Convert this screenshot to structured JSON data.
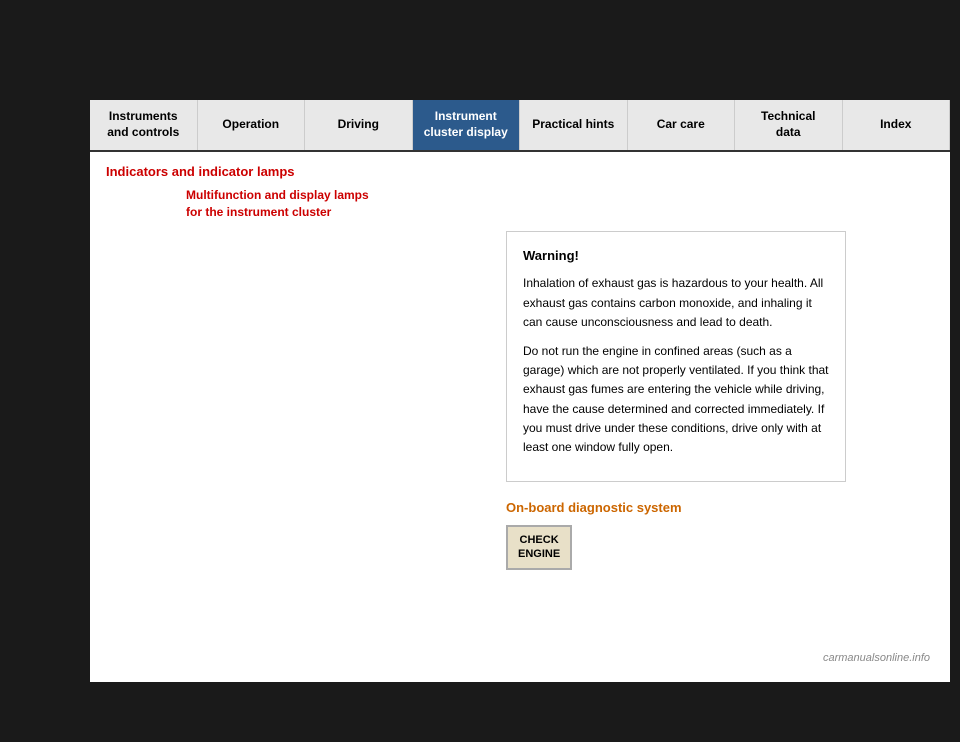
{
  "background": "#1a1a1a",
  "nav": {
    "items": [
      {
        "id": "instruments",
        "label": "Instruments\nand controls",
        "active": false
      },
      {
        "id": "operation",
        "label": "Operation",
        "active": false
      },
      {
        "id": "driving",
        "label": "Driving",
        "active": false
      },
      {
        "id": "instrument-cluster",
        "label": "Instrument\ncluster display",
        "active": true
      },
      {
        "id": "practical-hints",
        "label": "Practical hints",
        "active": false
      },
      {
        "id": "car-care",
        "label": "Car care",
        "active": false
      },
      {
        "id": "technical-data",
        "label": "Technical\ndata",
        "active": false
      },
      {
        "id": "index",
        "label": "Index",
        "active": false
      }
    ]
  },
  "breadcrumb": {
    "section": "Indicators and indicator lamps",
    "subsection": "Multifunction and display lamps\nfor the instrument cluster"
  },
  "warning": {
    "title": "Warning!",
    "paragraph1": "Inhalation of exhaust gas is hazardous to your health. All exhaust gas contains carbon monoxide, and inhaling it can cause unconsciousness and lead to death.",
    "paragraph2": "Do not run the engine in confined areas (such as a garage) which are not properly ventilated. If you think that exhaust gas fumes are entering the vehicle while driving, have the cause determined and corrected immediately. If you must drive under these conditions, drive only with at least one window fully open."
  },
  "diagnostics": {
    "title": "On-board diagnostic system",
    "button_line1": "CHECK",
    "button_line2": "ENGINE"
  },
  "watermark": "carmanualsonline.info"
}
